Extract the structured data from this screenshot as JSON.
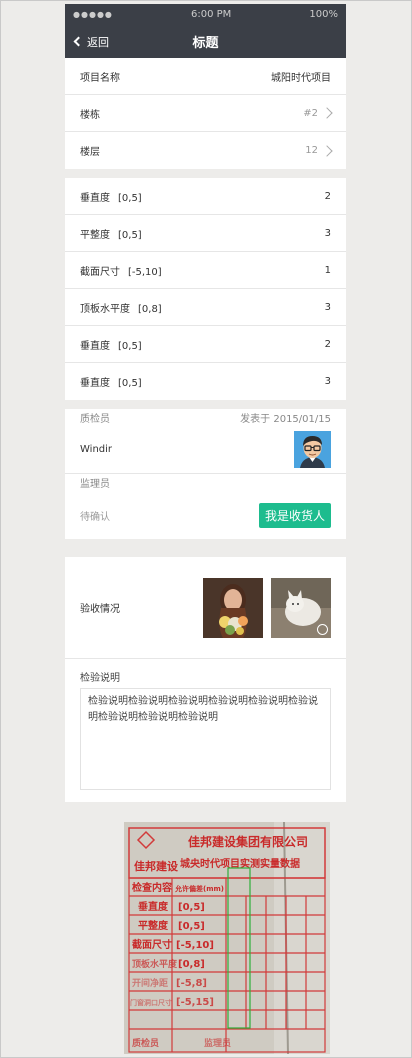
{
  "status_bar": {
    "signal": "●●●●●",
    "time": "6:00 PM",
    "battery": "100%"
  },
  "nav": {
    "back_label": "返回",
    "title": "标题"
  },
  "project": [
    {
      "label": "项目名称",
      "value": "城阳时代项目"
    },
    {
      "label": "楼栋",
      "value": "#2"
    },
    {
      "label": "楼层",
      "value": "12"
    }
  ],
  "checks": [
    {
      "label": "垂直度",
      "range": "[0,5]",
      "value": "2"
    },
    {
      "label": "平整度",
      "range": "[0,5]",
      "value": "3"
    },
    {
      "label": "截面尺寸",
      "range": "[-5,10]",
      "value": "1"
    },
    {
      "label": "顶板水平度",
      "range": "[0,8]",
      "value": "3"
    },
    {
      "label": "垂直度",
      "range": "[0,5]",
      "value": "2"
    },
    {
      "label": "垂直度",
      "range": "[0,5]",
      "value": "3"
    }
  ],
  "inspector": {
    "role": "质检员",
    "date": "发表于 2015/01/15",
    "name": "Windir"
  },
  "supervisor": {
    "role": "监理员",
    "status": "待确认",
    "button": "我是收货人"
  },
  "acceptance": {
    "label": "验收情况"
  },
  "description": {
    "label": "检验说明",
    "text": "检验说明检验说明检验说明检验说明检验说明检验说明检验说明检验说明检验说明"
  },
  "document": {
    "company": "佳邦建设集团有限公司",
    "brand": "佳邦建设",
    "subtitle": "城央时代项目实测实量数据",
    "header": "检查内容",
    "header2": "允许偏差(mm)",
    "items": [
      {
        "label": "垂直度",
        "range": "[0,5]"
      },
      {
        "label": "平整度",
        "range": "[0,5]"
      },
      {
        "label": "截面尺寸",
        "range": "[-5,10]"
      },
      {
        "label": "顶板水平度",
        "range": "[0,8]"
      },
      {
        "label": "开间净距",
        "range": "[-5,8]"
      },
      {
        "label": "门窗洞口尺寸",
        "range": "[-5,15]"
      }
    ],
    "footer": "质检员",
    "footer2": "监理员"
  }
}
